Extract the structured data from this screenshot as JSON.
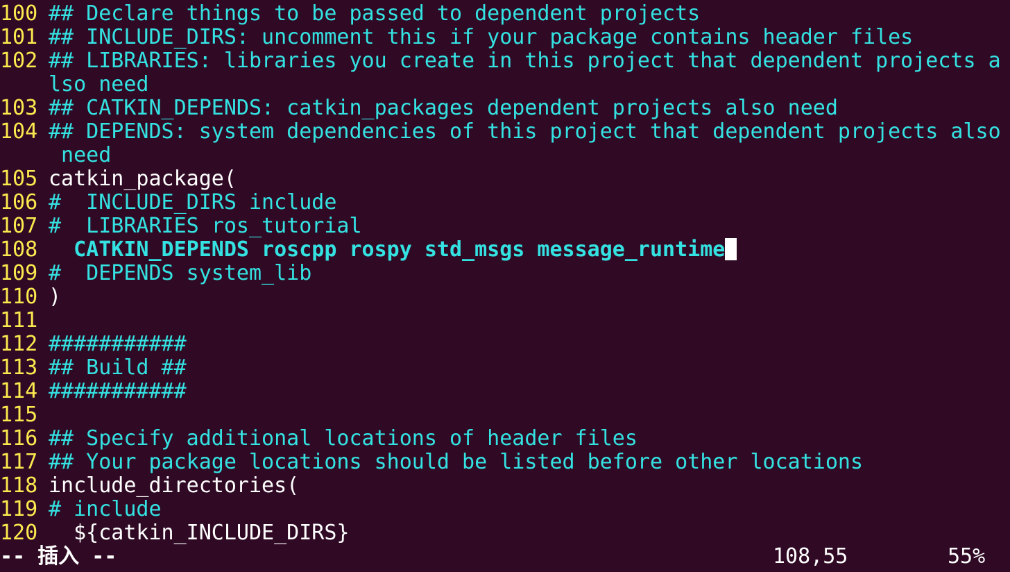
{
  "editor": {
    "lines": [
      {
        "num": "100",
        "type": "comment",
        "text": "## Declare things to be passed to dependent projects"
      },
      {
        "num": "101",
        "type": "comment",
        "text": "## INCLUDE_DIRS: uncomment this if your package contains header files"
      },
      {
        "num": "102",
        "type": "comment",
        "text": "## LIBRARIES: libraries you create in this project that dependent projects a"
      },
      {
        "num": "",
        "type": "comment",
        "text": "lso need"
      },
      {
        "num": "103",
        "type": "comment",
        "text": "## CATKIN_DEPENDS: catkin_packages dependent projects also need"
      },
      {
        "num": "104",
        "type": "comment",
        "text": "## DEPENDS: system dependencies of this project that dependent projects also"
      },
      {
        "num": "",
        "type": "comment",
        "text": " need"
      },
      {
        "num": "105",
        "type": "plain",
        "text": "catkin_package("
      },
      {
        "num": "106",
        "type": "comment",
        "text": "#  INCLUDE_DIRS include"
      },
      {
        "num": "107",
        "type": "comment",
        "text": "#  LIBRARIES ros_tutorial"
      },
      {
        "num": "108",
        "type": "keyword",
        "text": "  CATKIN_DEPENDS roscpp rospy std_msgs message_runtime",
        "cursor": true
      },
      {
        "num": "109",
        "type": "comment",
        "text": "#  DEPENDS system_lib"
      },
      {
        "num": "110",
        "type": "plain",
        "text": ")"
      },
      {
        "num": "111",
        "type": "plain",
        "text": ""
      },
      {
        "num": "112",
        "type": "comment",
        "text": "###########"
      },
      {
        "num": "113",
        "type": "comment",
        "text": "## Build ##"
      },
      {
        "num": "114",
        "type": "comment",
        "text": "###########"
      },
      {
        "num": "115",
        "type": "plain",
        "text": ""
      },
      {
        "num": "116",
        "type": "comment",
        "text": "## Specify additional locations of header files"
      },
      {
        "num": "117",
        "type": "comment",
        "text": "## Your package locations should be listed before other locations"
      },
      {
        "num": "118",
        "type": "plain",
        "text": "include_directories("
      },
      {
        "num": "119",
        "type": "comment",
        "text": "# include"
      },
      {
        "num": "120",
        "type": "plain",
        "text": "  ${catkin_INCLUDE_DIRS}"
      }
    ]
  },
  "status": {
    "mode": "-- 插入 --",
    "position": "108,55",
    "percent": "55%"
  },
  "colors": {
    "background": "#300a24",
    "line_number": "#fce94f",
    "comment": "#34e2e2",
    "plain": "#ffffff",
    "keyword": "#34e2e2",
    "cursor": "#ffffff"
  }
}
